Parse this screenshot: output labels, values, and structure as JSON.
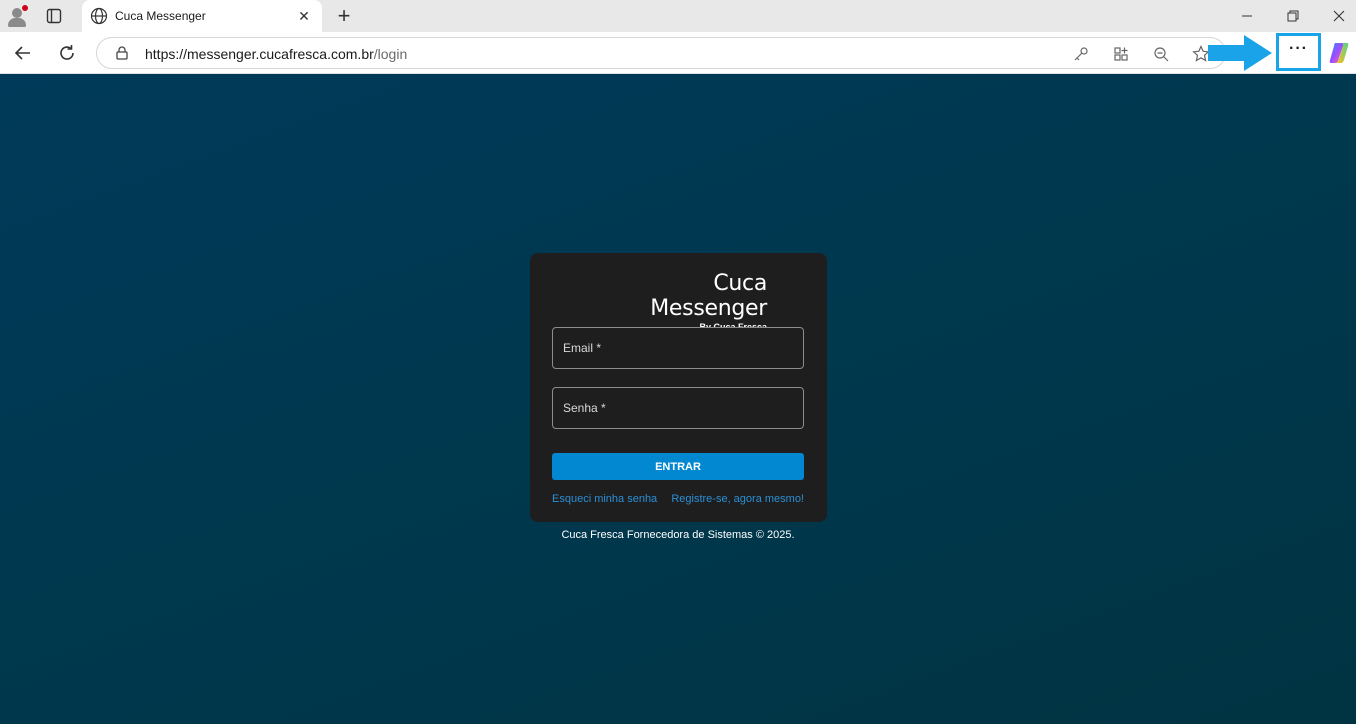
{
  "browser": {
    "tab_title": "Cuca Messenger",
    "url_host": "https://messenger.cucafresca.com.br",
    "url_path": "/login",
    "more_label": "···"
  },
  "login": {
    "brand_title": "Cuca Messenger",
    "brand_subtitle": "By Cuca Fresca",
    "email_label": "Email *",
    "password_label": "Senha *",
    "submit_label": "ENTRAR",
    "forgot_link": "Esqueci minha senha",
    "register_link": "Registre-se, agora mesmo!"
  },
  "footer": {
    "text": "Cuca Fresca Fornecedora de Sistemas © 2025."
  },
  "colors": {
    "background": "#003a5a",
    "card": "#1e1e1e",
    "button": "#0288d1",
    "link": "#2b8fd6",
    "highlight": "#1aa3e8"
  }
}
